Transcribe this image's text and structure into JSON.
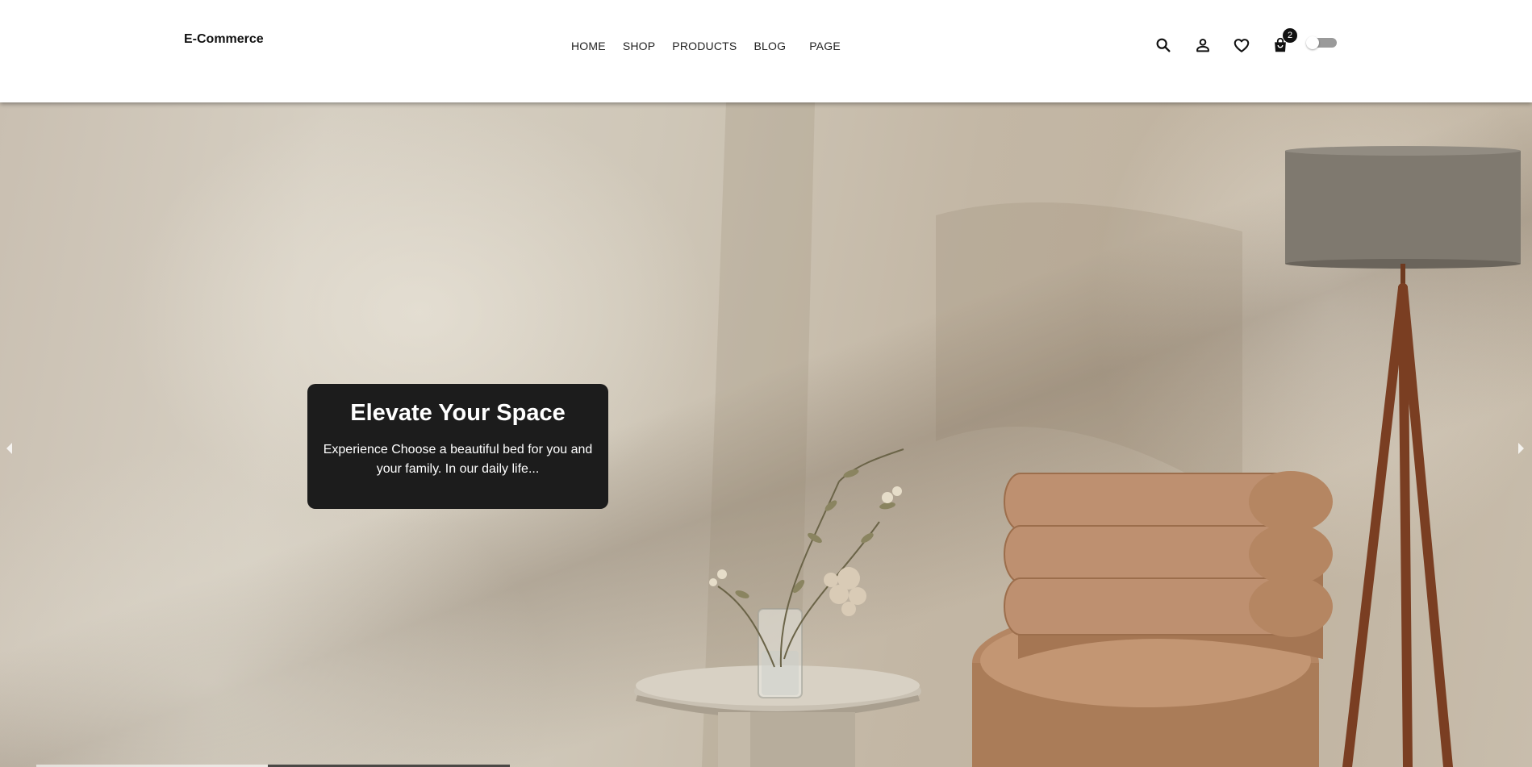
{
  "header": {
    "logo": "E-Commerce",
    "nav": [
      {
        "label": "HOME"
      },
      {
        "label": "SHOP"
      },
      {
        "label": "PRODUCTS"
      },
      {
        "label": "BLOG"
      },
      {
        "label": "PAGE"
      }
    ],
    "icons": [
      "search-icon",
      "user-icon",
      "heart-icon",
      "shopping-bag-icon"
    ],
    "cart_count": "2",
    "theme_toggle": "off"
  },
  "hero": {
    "title": "Elevate Your Space",
    "text": "Experience Choose a beautiful bed for you and your family. In our daily life...",
    "prev_icon": "chevron-left-icon",
    "next_icon": "chevron-right-icon"
  },
  "colors": {
    "caption_bg": "#1c1c1c",
    "chair": "#b58866",
    "lamp_shade": "#7d776d",
    "lamp_leg": "#7a3e22"
  }
}
